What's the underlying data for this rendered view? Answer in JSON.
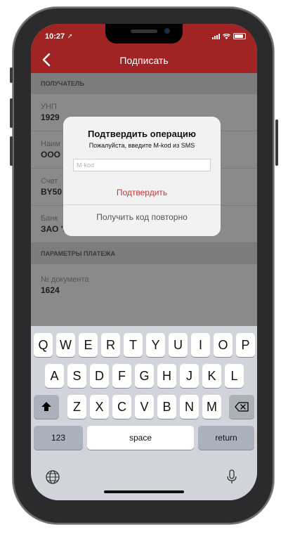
{
  "status": {
    "time": "10:27"
  },
  "nav": {
    "title": "Подписать"
  },
  "sections": {
    "recipient": "ПОЛУЧАТЕЛЬ",
    "payment": "ПАРАМЕТРЫ ПЛАТЕЖА"
  },
  "fields": [
    {
      "label": "УНП",
      "value": "1929"
    },
    {
      "label": "Наим",
      "value": "ООО"
    },
    {
      "label": "Счет",
      "value": "BY50"
    },
    {
      "label": "Банк",
      "value": "ЗАО 'БСБ БАНК'"
    }
  ],
  "doc_field": {
    "label": "№ документа",
    "value": "1624"
  },
  "alert": {
    "title": "Подтвердить операцию",
    "message": "Пожалуйста, введите M-kod из SMS",
    "input_placeholder": "M-kod",
    "confirm_label": "Подтвердить",
    "resend_label": "Получить код повторно"
  },
  "keyboard": {
    "row1": [
      "Q",
      "W",
      "E",
      "R",
      "T",
      "Y",
      "U",
      "I",
      "O",
      "P"
    ],
    "row2": [
      "A",
      "S",
      "D",
      "F",
      "G",
      "H",
      "J",
      "K",
      "L"
    ],
    "row3": [
      "Z",
      "X",
      "C",
      "V",
      "B",
      "N",
      "M"
    ],
    "numbers_label": "123",
    "space_label": "space",
    "return_label": "return"
  },
  "colors": {
    "header": "#a02424",
    "accent": "#d2342f"
  }
}
